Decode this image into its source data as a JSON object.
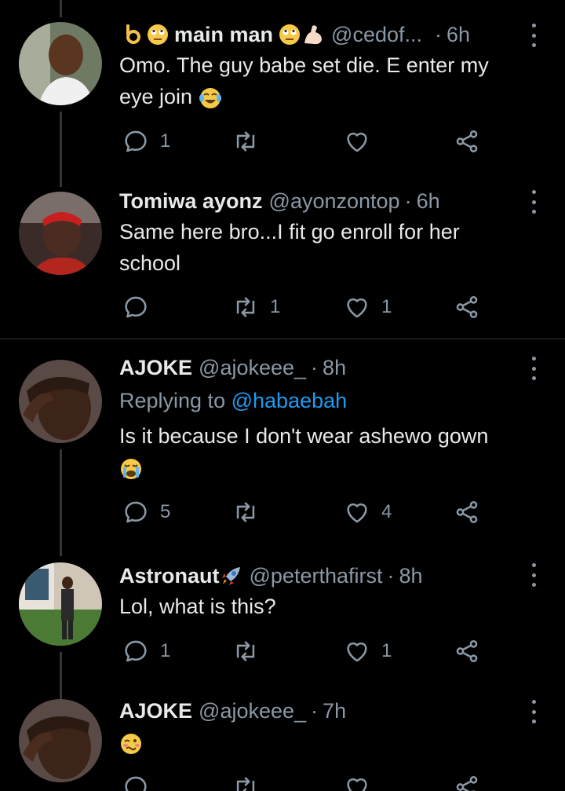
{
  "tweets": [
    {
      "name": "main man",
      "handle": "@cedof...",
      "time": "6h",
      "text_line1": "Omo. The guy babe set die. E enter my",
      "text_line2": "eye join",
      "reply_count": "1",
      "retweet_count": "",
      "like_count": ""
    },
    {
      "name": "Tomiwa ayonz",
      "handle": "@ayonzontop",
      "time": "6h",
      "text_line1": "Same here bro...I fit go enroll for her",
      "text_line2": "school",
      "reply_count": "",
      "retweet_count": "1",
      "like_count": "1"
    },
    {
      "name": "AJOKE",
      "handle": "@ajokeee_",
      "time": "8h",
      "replying_prefix": "Replying to",
      "replying_handle": "@habaebah",
      "text_line1": "Is it because I don't wear ashewo gown",
      "reply_count": "5",
      "retweet_count": "",
      "like_count": "4"
    },
    {
      "name": "Astronaut",
      "handle": "@peterthafirst",
      "time": "8h",
      "text_line1": "Lol, what is this?",
      "reply_count": "1",
      "retweet_count": "",
      "like_count": "1"
    },
    {
      "name": "AJOKE",
      "handle": "@ajokeee_",
      "time": "7h"
    }
  ],
  "separator": "·",
  "colors": {
    "background": "#000000",
    "text": "#e7e9ea",
    "muted": "#8b98a5",
    "link": "#1d9bf0"
  },
  "icons": [
    "reply-icon",
    "retweet-icon",
    "like-icon",
    "share-icon",
    "more-icon"
  ]
}
